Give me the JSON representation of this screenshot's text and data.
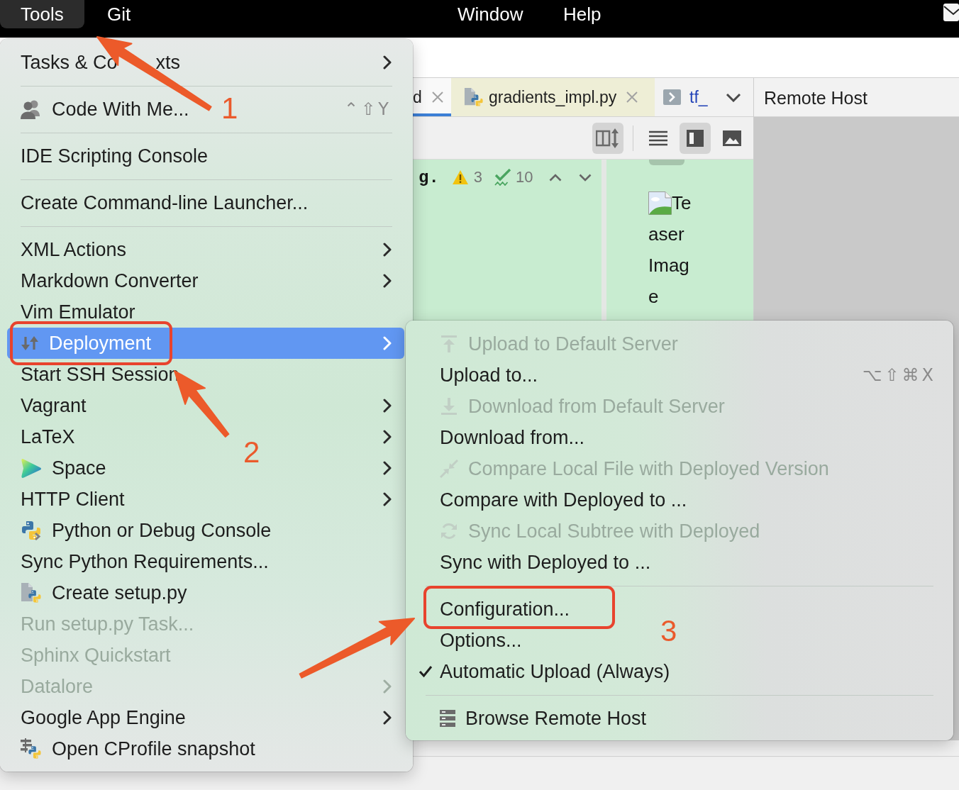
{
  "menu_bar": [
    {
      "label": "Tools",
      "selected": true
    },
    {
      "label": "Git",
      "selected": false
    },
    {
      "label": "Window",
      "selected": false
    },
    {
      "label": "Help",
      "selected": false
    }
  ],
  "editor_tabs": [
    {
      "label": "d",
      "kind": "plain",
      "selected": true,
      "modified": false,
      "close_button": true
    },
    {
      "label": "gradients_impl.py",
      "kind": "python",
      "selected": false,
      "modified": false,
      "close_button": true,
      "color": "#eeeed6"
    },
    {
      "label": "tf_",
      "kind": "console",
      "selected": false,
      "modified": true,
      "close_button": false
    }
  ],
  "toolbar_buttons": [
    {
      "kind": "orientation",
      "selected": true
    },
    {
      "kind": "editor",
      "selected": false
    },
    {
      "kind": "split",
      "selected": true
    },
    {
      "kind": "preview",
      "selected": false
    }
  ],
  "editor": {
    "code_fragment": "g.",
    "warning_count": "3",
    "check_count": "10"
  },
  "preview": {
    "alt_text_lines": [
      "Te",
      "aser",
      "Imag",
      "e"
    ]
  },
  "remote_host_panel": {
    "title": "Remote Host"
  },
  "main_menu": {
    "sections": [
      {
        "items": [
          {
            "label": "Tasks & Co",
            "label_tail": "xts",
            "kind": "plain",
            "selected": false,
            "disabled": false,
            "submenu": true
          }
        ]
      },
      {
        "items": [
          {
            "label": "Code With Me...",
            "kind": "collab",
            "shortcut": "⌃⇧Y",
            "selected": false,
            "disabled": false,
            "submenu": false
          }
        ]
      },
      {
        "items": [
          {
            "label": "IDE Scripting Console",
            "kind": "plain",
            "selected": false,
            "disabled": false,
            "submenu": false
          }
        ]
      },
      {
        "items": [
          {
            "label": "Create Command-line Launcher...",
            "kind": "plain",
            "selected": false,
            "disabled": false,
            "submenu": false
          }
        ]
      },
      {
        "items": [
          {
            "label": "XML Actions",
            "kind": "plain",
            "selected": false,
            "disabled": false,
            "submenu": true
          },
          {
            "label": "Markdown Converter",
            "kind": "plain",
            "selected": false,
            "disabled": false,
            "submenu": true
          },
          {
            "label": "Vim Emulator",
            "kind": "plain",
            "selected": false,
            "disabled": false,
            "submenu": false
          },
          {
            "label": "Deployment",
            "kind": "deploy",
            "selected": true,
            "disabled": false,
            "submenu": true
          },
          {
            "label": "Start SSH Session",
            "kind": "plain",
            "selected": false,
            "disabled": false,
            "submenu": false
          },
          {
            "label": "Vagrant",
            "kind": "plain",
            "selected": false,
            "disabled": false,
            "submenu": true
          },
          {
            "label": "LaTeX",
            "kind": "plain",
            "selected": false,
            "disabled": false,
            "submenu": true
          },
          {
            "label": "Space",
            "kind": "space",
            "selected": false,
            "disabled": false,
            "submenu": true
          },
          {
            "label": "HTTP Client",
            "kind": "plain",
            "selected": false,
            "disabled": false,
            "submenu": true
          },
          {
            "label": "Python or Debug Console",
            "kind": "python",
            "selected": false,
            "disabled": false,
            "submenu": false
          },
          {
            "label": "Sync Python Requirements...",
            "kind": "plain",
            "selected": false,
            "disabled": false,
            "submenu": false
          },
          {
            "label": "Create setup.py",
            "kind": "setup",
            "selected": false,
            "disabled": false,
            "submenu": false
          },
          {
            "label": "Run setup.py Task...",
            "kind": "plain",
            "selected": false,
            "disabled": true,
            "submenu": false
          },
          {
            "label": "Sphinx Quickstart",
            "kind": "plain",
            "selected": false,
            "disabled": true,
            "submenu": false
          },
          {
            "label": "Datalore",
            "kind": "plain",
            "selected": false,
            "disabled": true,
            "submenu": true
          },
          {
            "label": "Google App Engine",
            "kind": "plain",
            "selected": false,
            "disabled": false,
            "submenu": true
          },
          {
            "label": "Open CProfile snapshot",
            "kind": "profiler",
            "selected": false,
            "disabled": false,
            "submenu": false
          }
        ]
      }
    ]
  },
  "deployment_submenu": {
    "sections": [
      {
        "items": [
          {
            "label": "Upload to Default Server",
            "kind": "upload",
            "selected": false,
            "disabled": true,
            "checked": false
          },
          {
            "label": "Upload to...",
            "kind": "plain",
            "shortcut": "⌥⇧⌘X",
            "selected": false,
            "disabled": false,
            "checked": false
          },
          {
            "label": "Download from Default Server",
            "kind": "download",
            "selected": false,
            "disabled": true,
            "checked": false
          },
          {
            "label": "Download from...",
            "kind": "plain",
            "selected": false,
            "disabled": false,
            "checked": false
          },
          {
            "label": "Compare Local File with Deployed Version",
            "kind": "compare",
            "selected": false,
            "disabled": true,
            "checked": false
          },
          {
            "label": "Compare with Deployed to ...",
            "kind": "plain",
            "selected": false,
            "disabled": false,
            "checked": false
          },
          {
            "label": "Sync Local Subtree with Deployed",
            "kind": "sync",
            "selected": false,
            "disabled": true,
            "checked": false
          },
          {
            "label": "Sync with Deployed to ...",
            "kind": "plain",
            "selected": false,
            "disabled": false,
            "checked": false
          }
        ]
      },
      {
        "items": [
          {
            "label": "Configuration...",
            "kind": "plain",
            "selected": false,
            "disabled": false,
            "checked": false
          },
          {
            "label": "Options...",
            "kind": "plain",
            "selected": false,
            "disabled": false,
            "checked": false
          },
          {
            "label": "Automatic Upload (Always)",
            "kind": "plain",
            "selected": false,
            "disabled": false,
            "checked": true
          }
        ]
      },
      {
        "items": [
          {
            "label": "Browse Remote Host",
            "kind": "browse",
            "selected": false,
            "disabled": false,
            "checked": false
          }
        ]
      }
    ]
  },
  "annotations": [
    {
      "kind": "arrow",
      "label": "1"
    },
    {
      "kind": "frame"
    },
    {
      "kind": "arrow",
      "label": "2"
    },
    {
      "kind": "frame"
    },
    {
      "kind": "arrow",
      "label": "3"
    }
  ]
}
